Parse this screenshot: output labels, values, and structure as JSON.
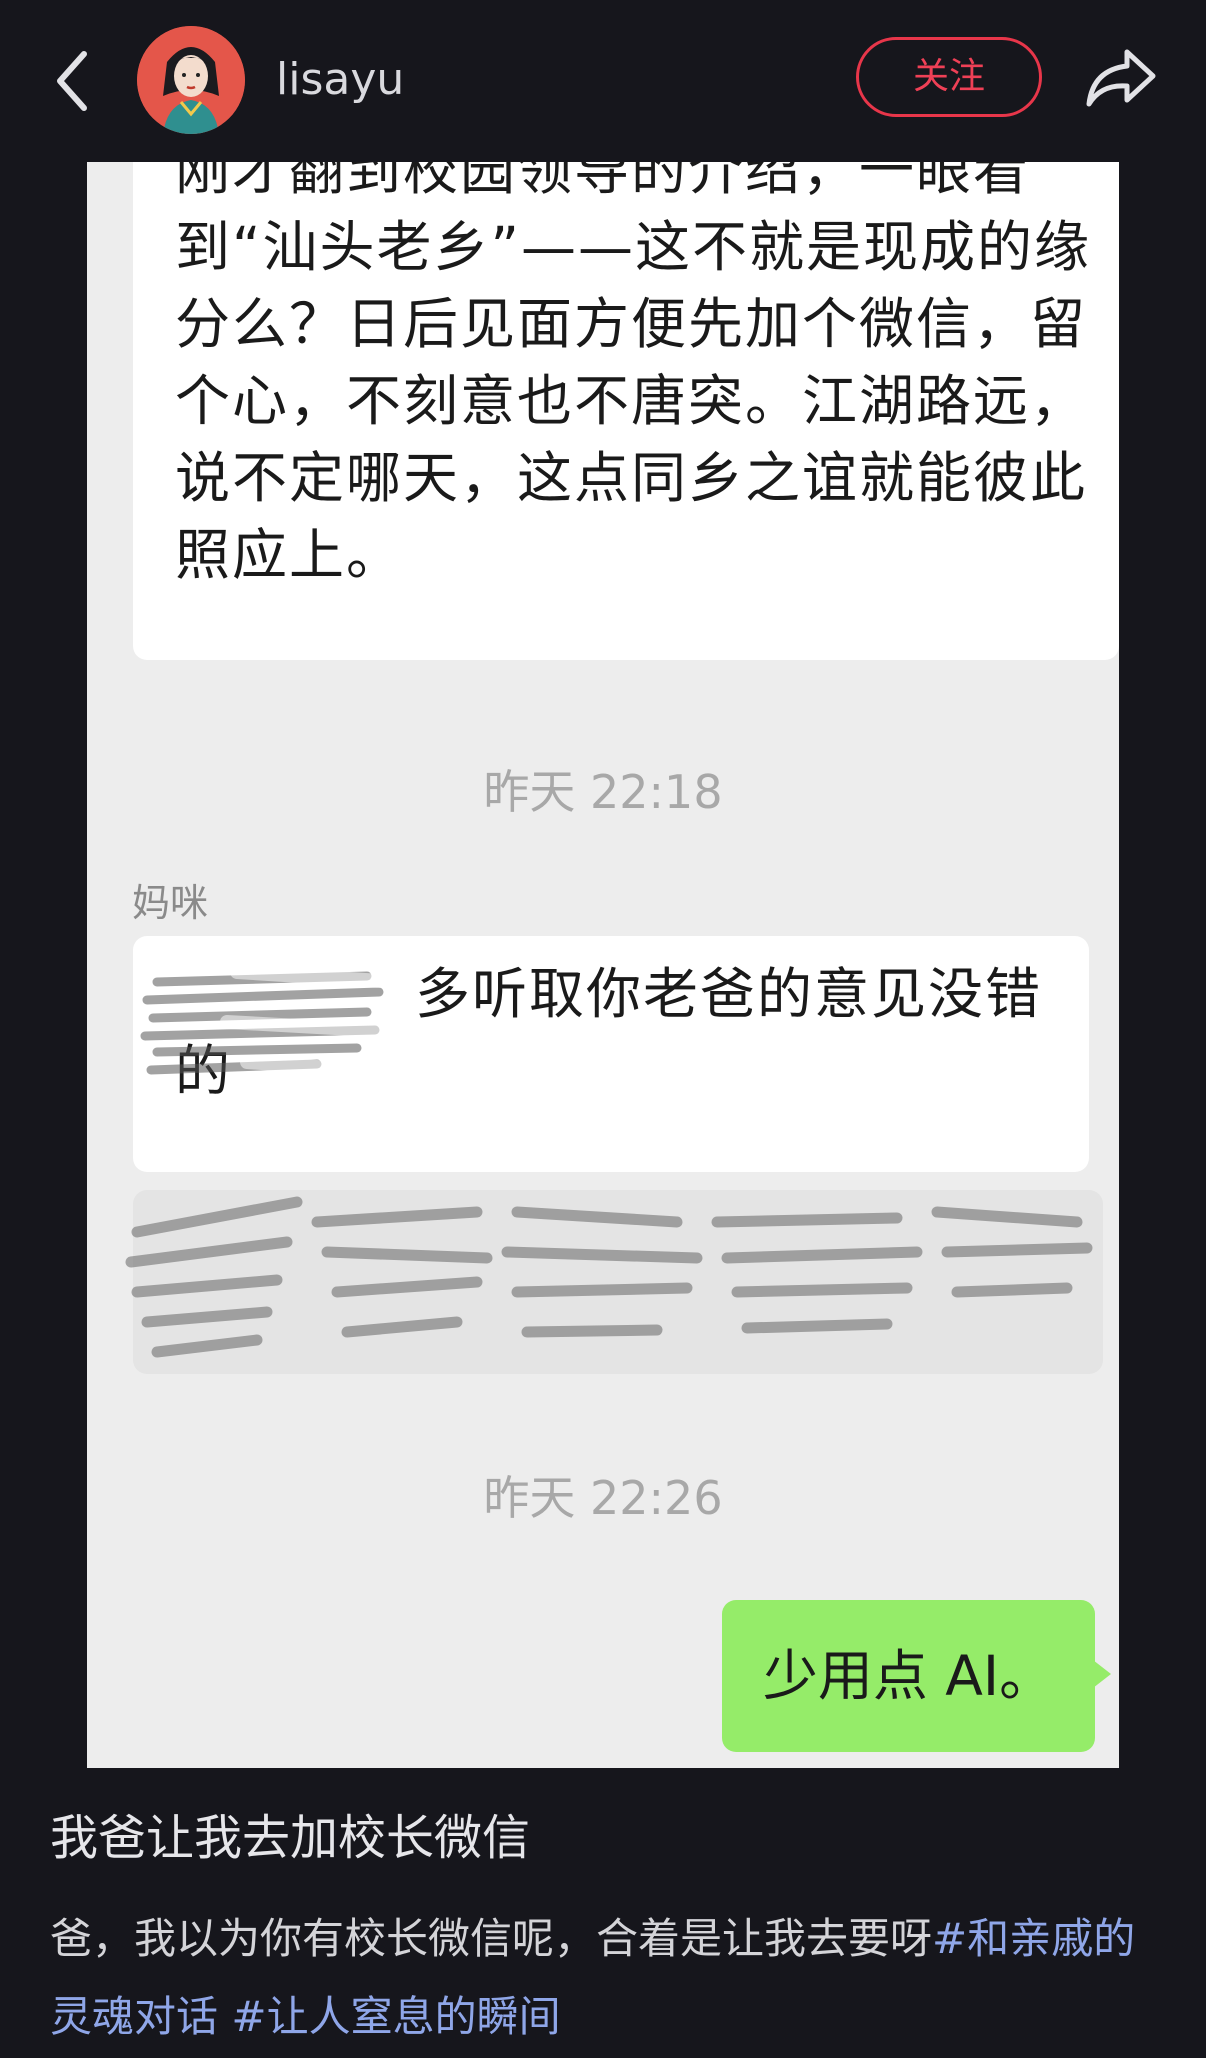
{
  "header": {
    "username": "lisayu",
    "follow_label": "关注",
    "icons": [
      "back-arrow-icon",
      "avatar",
      "share-icon"
    ]
  },
  "chat": {
    "message1": "刚才翻到校园领导的介绍，一眼看到“汕头老乡”——这不就是现成的缘分么？日后见面方便先加个微信，留个心，不刻意也不唐突。江湖路远，说不定哪天，这点同乡之谊就能彼此照应上。",
    "timestamp1": "昨天 22:18",
    "sender_name": "妈咪",
    "message2": "多听取你老爸的意见没错的",
    "timestamp2": "昨天 22:26",
    "reply": "少用点 AI。"
  },
  "post": {
    "title": "我爸让我去加校长微信",
    "body_text": "爸，我以为你有校长微信呢，合着是让我去要呀",
    "hashtag1": "#和亲戚的灵魂对话",
    "hashtag2": "#让人窒息的瞬间"
  },
  "colors": {
    "follow": "#ef4056",
    "reply_bubble": "#95ec69",
    "hashtag": "#8fa6e8",
    "background": "#16161c"
  }
}
